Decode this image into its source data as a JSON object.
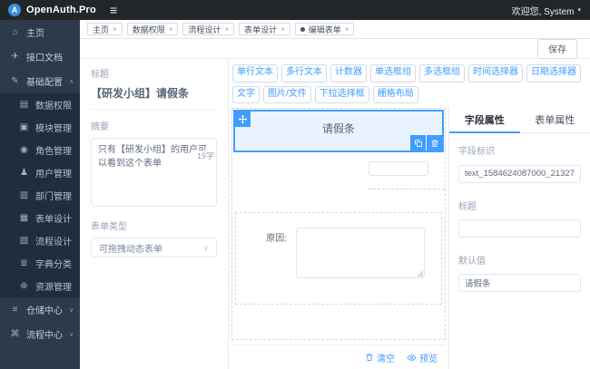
{
  "colors": {
    "accent": "#409eff",
    "topbar_bg": "#232629",
    "sidebar_bg": "#2d3a4b",
    "submenu_bg": "#1f2d3d",
    "selected_bg": "#e9f3fd"
  },
  "icons": {
    "logo": "A",
    "hamburger": "≡",
    "caret_down_small": "▾",
    "caret_up": "∧",
    "caret_down": "∨",
    "close": "×",
    "select_chevron": "∨",
    "home": "⌂",
    "api": "✈",
    "config": "✎",
    "data_perm": "▤",
    "module": "▣",
    "role": "◉",
    "user": "♟",
    "dept": "▥",
    "form": "▦",
    "flow": "▧",
    "dict": "≣",
    "resource": "⊕",
    "warehouse": "≡",
    "flow_center": "⌘"
  },
  "header": {
    "brand": "OpenAuth.Pro",
    "welcome": "欢迎您, System"
  },
  "sidebar": {
    "items": [
      {
        "label": "主页"
      },
      {
        "label": "接口文档"
      },
      {
        "label": "基础配置",
        "children": [
          {
            "label": "数据权限"
          },
          {
            "label": "模块管理"
          },
          {
            "label": "角色管理"
          },
          {
            "label": "用户管理"
          },
          {
            "label": "部门管理"
          },
          {
            "label": "表单设计"
          },
          {
            "label": "流程设计"
          },
          {
            "label": "字典分类"
          },
          {
            "label": "资源管理"
          }
        ]
      },
      {
        "label": "仓储中心"
      },
      {
        "label": "流程中心"
      }
    ]
  },
  "tags": [
    {
      "label": "主页"
    },
    {
      "label": "数据权限"
    },
    {
      "label": "流程设计"
    },
    {
      "label": "表单设计"
    },
    {
      "label": "编辑表单",
      "active": true
    }
  ],
  "toolbar": {
    "save_label": "保存"
  },
  "form_meta": {
    "title_label": "标题",
    "title_value": "【研发小组】请假条",
    "summary_label": "摘要",
    "summary_value": "只有【研发小组】的用户可以看到这个表单",
    "summary_count": "19字",
    "type_label": "表单类型",
    "type_value": "可拖拽动态表单"
  },
  "palette": {
    "buttons": [
      "单行文本",
      "多行文本",
      "计数器",
      "单选框组",
      "多选框组",
      "时间选择器",
      "日期选择器",
      "文字",
      "图片/文件",
      "下拉选择框",
      "栅格布局"
    ]
  },
  "canvas": {
    "component_title": "请假条",
    "reason_label": "原因:",
    "clear_label": "清空",
    "preview_label": "预览"
  },
  "props": {
    "tab_field": "字段属性",
    "tab_form": "表单属性",
    "field_id_label": "字段标识",
    "field_id_value": "text_1584624087000_21327",
    "title_label": "标题",
    "title_value": "",
    "default_label": "默认值",
    "default_value": "请假条"
  }
}
